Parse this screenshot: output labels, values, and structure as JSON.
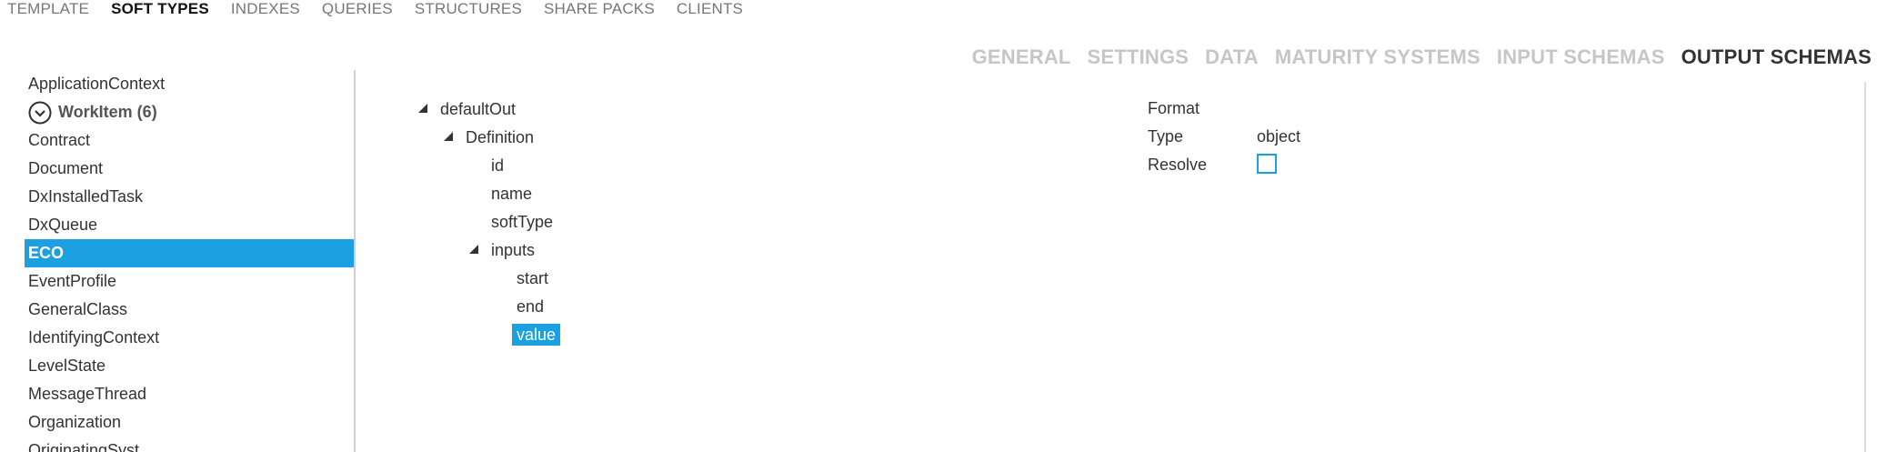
{
  "topnav": [
    {
      "label": "TEMPLATE",
      "active": false
    },
    {
      "label": "SOFT TYPES",
      "active": true
    },
    {
      "label": "INDEXES",
      "active": false
    },
    {
      "label": "QUERIES",
      "active": false
    },
    {
      "label": "STRUCTURES",
      "active": false
    },
    {
      "label": "SHARE PACKS",
      "active": false
    },
    {
      "label": "CLIENTS",
      "active": false
    }
  ],
  "subtabs": [
    {
      "label": "GENERAL",
      "active": false
    },
    {
      "label": "SETTINGS",
      "active": false
    },
    {
      "label": "DATA",
      "active": false
    },
    {
      "label": "MATURITY SYSTEMS",
      "active": false
    },
    {
      "label": "INPUT SCHEMAS",
      "active": false
    },
    {
      "label": "OUTPUT SCHEMAS",
      "active": true
    }
  ],
  "sidebar": {
    "items": [
      {
        "label": "ApplicationContext",
        "type": "item"
      },
      {
        "label": "WorkItem (6)",
        "type": "group",
        "icon": "chevron-down-circle-icon"
      },
      {
        "label": "Contract",
        "type": "item"
      },
      {
        "label": "Document",
        "type": "item"
      },
      {
        "label": "DxInstalledTask",
        "type": "item"
      },
      {
        "label": "DxQueue",
        "type": "item"
      },
      {
        "label": "ECO",
        "type": "item",
        "selected": true
      },
      {
        "label": "EventProfile",
        "type": "item"
      },
      {
        "label": "GeneralClass",
        "type": "item"
      },
      {
        "label": "IdentifyingContext",
        "type": "item"
      },
      {
        "label": "LevelState",
        "type": "item"
      },
      {
        "label": "MessageThread",
        "type": "item"
      },
      {
        "label": "Organization",
        "type": "item"
      },
      {
        "label": "OriginatingSyst...",
        "type": "item"
      }
    ]
  },
  "tree": [
    {
      "label": "defaultOut",
      "depth": 0,
      "expanded": true
    },
    {
      "label": "Definition",
      "depth": 1,
      "expanded": true
    },
    {
      "label": "id",
      "depth": 2
    },
    {
      "label": "name",
      "depth": 2
    },
    {
      "label": "softType",
      "depth": 2
    },
    {
      "label": "inputs",
      "depth": 2,
      "expanded": true
    },
    {
      "label": "start",
      "depth": 3
    },
    {
      "label": "end",
      "depth": 3
    },
    {
      "label": "value",
      "depth": 3,
      "selected": true
    }
  ],
  "props": {
    "format": {
      "label": "Format",
      "value": ""
    },
    "type": {
      "label": "Type",
      "value": "object"
    },
    "resolve": {
      "label": "Resolve",
      "checked": false
    }
  },
  "colors": {
    "accent": "#1ba1e2",
    "inactive_tab": "#c6c6c6",
    "text": "#333333"
  }
}
